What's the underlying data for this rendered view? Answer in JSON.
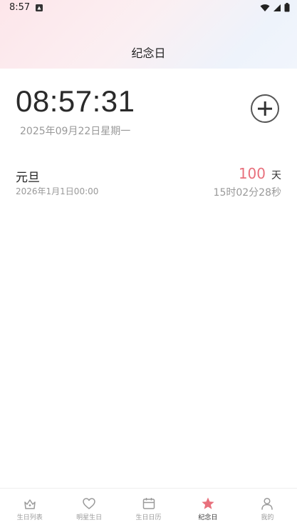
{
  "status_bar": {
    "time": "8:57"
  },
  "header": {
    "title": "纪念日"
  },
  "clock": {
    "time": "08:57:31",
    "date": "2025年09月22日星期一"
  },
  "events": [
    {
      "name": "元旦",
      "datetime": "2026年1月1日00:00",
      "days": "100",
      "days_unit": "天",
      "remaining": "15时02分28秒"
    }
  ],
  "bottom_nav": {
    "items": [
      {
        "label": "生日列表",
        "icon": "cake-icon",
        "active": false
      },
      {
        "label": "明星生日",
        "icon": "heart-icon",
        "active": false
      },
      {
        "label": "生日日历",
        "icon": "calendar-icon",
        "active": false
      },
      {
        "label": "纪念日",
        "icon": "star-icon",
        "active": true
      },
      {
        "label": "我的",
        "icon": "person-icon",
        "active": false
      }
    ],
    "active_color": "#e8707c",
    "inactive_color": "#9a9a9a"
  }
}
